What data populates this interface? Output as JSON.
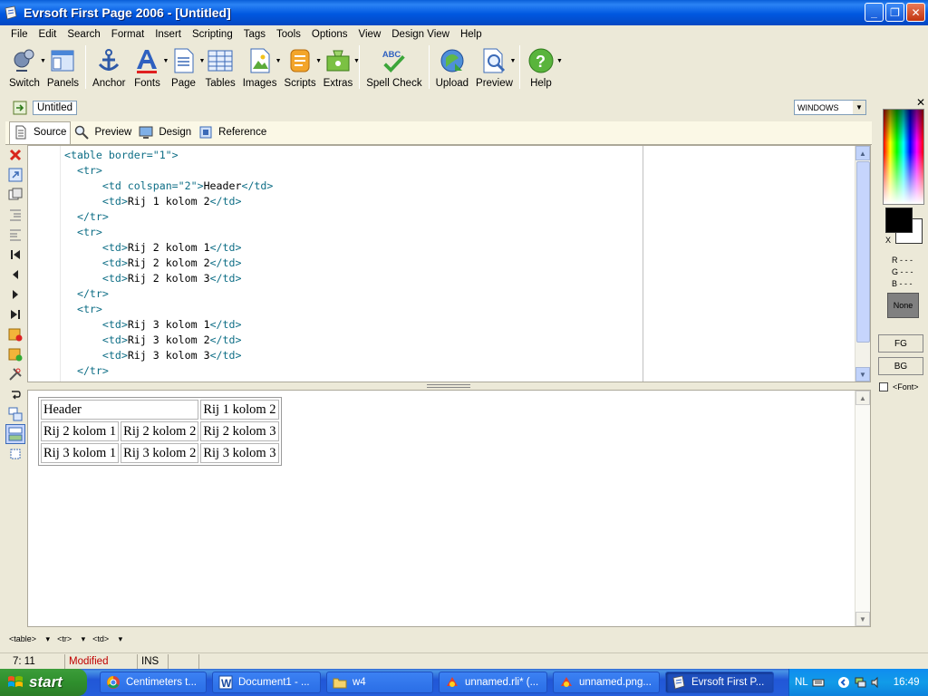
{
  "window": {
    "title": "Evrsoft First Page 2006 - [Untitled]",
    "controls": {
      "minimize": "_",
      "maximize": "❐",
      "close": "✕"
    }
  },
  "menu": [
    "File",
    "Edit",
    "Search",
    "Format",
    "Insert",
    "Scripting",
    "Tags",
    "Tools",
    "Options",
    "View",
    "Design View",
    "Help"
  ],
  "toolbar": {
    "items": [
      {
        "label": "Switch",
        "icon": "switch-icon"
      },
      {
        "label": "Panels",
        "icon": "panels-icon"
      },
      {
        "label": "Anchor",
        "icon": "anchor-icon"
      },
      {
        "label": "Fonts",
        "icon": "fonts-icon"
      },
      {
        "label": "Page",
        "icon": "page-icon"
      },
      {
        "label": "Tables",
        "icon": "tables-icon"
      },
      {
        "label": "Images",
        "icon": "images-icon"
      },
      {
        "label": "Scripts",
        "icon": "scripts-icon"
      },
      {
        "label": "Extras",
        "icon": "extras-icon"
      },
      {
        "label": "Spell Check",
        "icon": "spellcheck-icon"
      },
      {
        "label": "Upload",
        "icon": "upload-icon"
      },
      {
        "label": "Preview",
        "icon": "preview-icon"
      },
      {
        "label": "Help",
        "icon": "help-icon"
      }
    ]
  },
  "document": {
    "tab": "Untitled",
    "view_mode": "WINDOWS"
  },
  "view_tabs": [
    "Source",
    "Preview",
    "Design",
    "Reference"
  ],
  "editor": {
    "lines": [
      {
        "indent": "",
        "open": "<table border=\"1\">",
        "text": "",
        "close": ""
      },
      {
        "indent": "  ",
        "open": "<tr>",
        "text": "",
        "close": ""
      },
      {
        "indent": "      ",
        "open": "<td colspan=\"2\">",
        "text": "Header",
        "close": "</td>"
      },
      {
        "indent": "      ",
        "open": "<td>",
        "text": "Rij 1 kolom 2",
        "close": "</td>"
      },
      {
        "indent": "  ",
        "open": "</tr>",
        "text": "",
        "close": ""
      },
      {
        "indent": "  ",
        "open": "<tr>",
        "text": "",
        "close": ""
      },
      {
        "indent": "      ",
        "open": "<td>",
        "text": "Rij 2 kolom 1",
        "close": "</td>"
      },
      {
        "indent": "      ",
        "open": "<td>",
        "text": "Rij 2 kolom 2",
        "close": "</td>"
      },
      {
        "indent": "      ",
        "open": "<td>",
        "text": "Rij 2 kolom 3",
        "close": "</td>"
      },
      {
        "indent": "  ",
        "open": "</tr>",
        "text": "",
        "close": ""
      },
      {
        "indent": "  ",
        "open": "<tr>",
        "text": "",
        "close": ""
      },
      {
        "indent": "      ",
        "open": "<td>",
        "text": "Rij 3 kolom 1",
        "close": "</td>"
      },
      {
        "indent": "      ",
        "open": "<td>",
        "text": "Rij 3 kolom 2",
        "close": "</td>"
      },
      {
        "indent": "      ",
        "open": "<td>",
        "text": "Rij 3 kolom 3",
        "close": "</td>"
      },
      {
        "indent": "  ",
        "open": "</tr>",
        "text": "",
        "close": ""
      }
    ]
  },
  "preview_table": {
    "rows": [
      [
        {
          "text": "Header",
          "colspan": 2
        },
        {
          "text": "Rij 1 kolom 2"
        }
      ],
      [
        {
          "text": "Rij 2 kolom 1"
        },
        {
          "text": "Rij 2 kolom 2"
        },
        {
          "text": "Rij 2 kolom 3"
        }
      ],
      [
        {
          "text": "Rij 3 kolom 1"
        },
        {
          "text": "Rij 3 kolom 2"
        },
        {
          "text": "Rij 3 kolom 3"
        }
      ]
    ]
  },
  "tag_crumbs": [
    "<table>",
    "<tr>",
    "<td>"
  ],
  "status": {
    "position": "7: 11",
    "modified": "Modified",
    "mode": "INS",
    "modified_color": "#c00000"
  },
  "color_panel": {
    "swap_label": "X",
    "r": "R - - -",
    "g": "G - - -",
    "b": "B - - -",
    "none_label": "None",
    "fg_label": "FG",
    "bg_label": "BG",
    "font_label": "<Font>",
    "fg_color": "#000000",
    "bg_color": "#ffffff"
  },
  "taskbar": {
    "start": "start",
    "tasks": [
      {
        "label": "Centimeters t...",
        "icon": "chrome-icon"
      },
      {
        "label": "Document1 - ...",
        "icon": "word-icon"
      },
      {
        "label": "w4",
        "icon": "folder-icon"
      },
      {
        "label": "unnamed.rli* (...",
        "icon": "app-icon"
      },
      {
        "label": "unnamed.png...",
        "icon": "app-icon"
      },
      {
        "label": "Evrsoft First P...",
        "icon": "firstpage-icon",
        "active": true
      }
    ],
    "lang": "NL",
    "clock": "16:49"
  }
}
